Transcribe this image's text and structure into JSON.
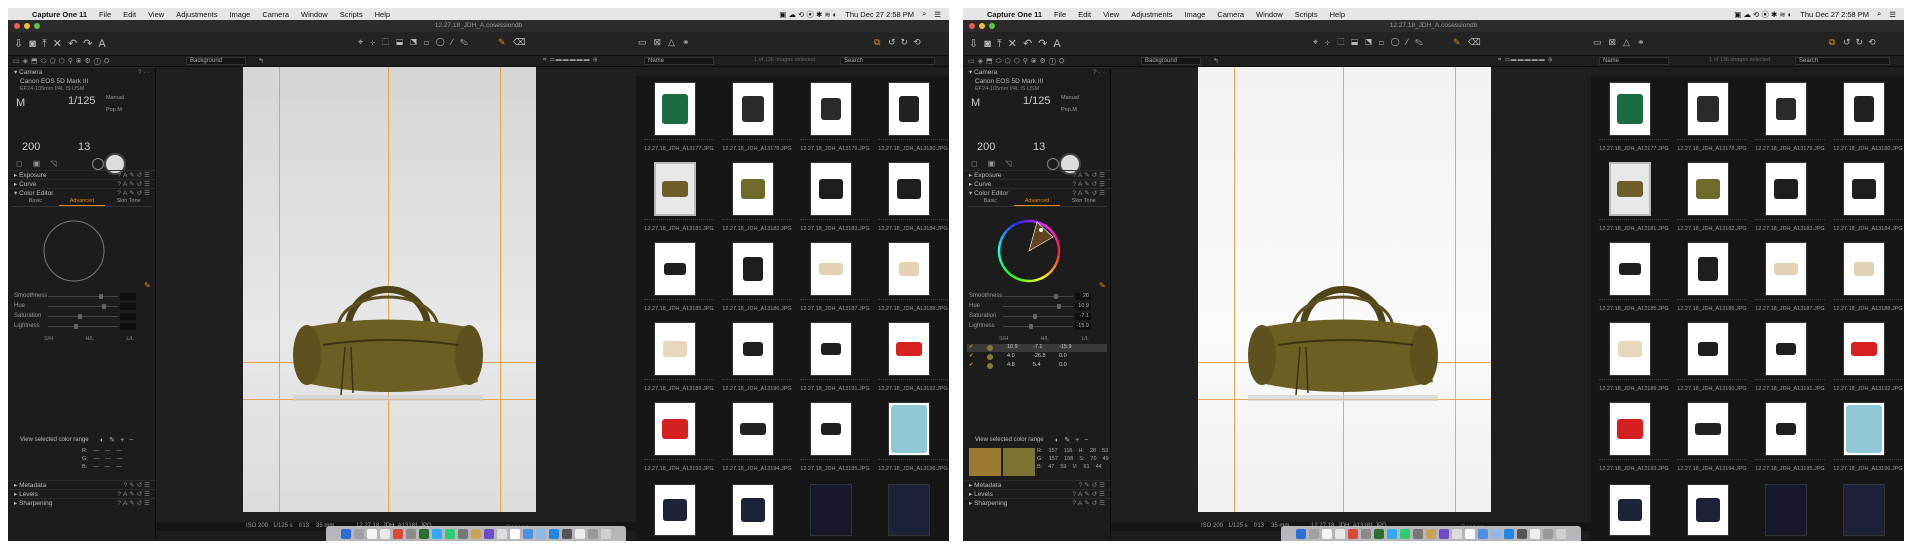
{
  "menubar": {
    "app": "Capture One 11",
    "items": [
      "File",
      "Edit",
      "View",
      "Adjustments",
      "Image",
      "Camera",
      "Window",
      "Scripts",
      "Help"
    ],
    "clock": "Thu Dec 27  2:58 PM"
  },
  "window": {
    "title": "12.27.18_JDH_A.cosessiondb"
  },
  "subbar": {
    "background_label": "Background",
    "filter_label": "Name",
    "selection_status": "1 of 136 images selected",
    "search_placeholder": "Search"
  },
  "left_panel": {
    "camera_title": "Camera",
    "camera_model": "Canon EOS 5D Mark III",
    "lens": "EF24-105mm f/4L IS USM",
    "mode": "M",
    "shutter": "1/125",
    "iso": "200",
    "aperture": "13",
    "manual_label": "Manual",
    "pop_label": "Pop.M",
    "exposure": "Exposure",
    "curve": "Curve",
    "color_editor": "Color Editor",
    "tabs": [
      "Basic",
      "Advanced",
      "Skin Tone"
    ],
    "sliders": [
      "Smoothness",
      "Hue",
      "Saturation",
      "Lightness"
    ],
    "shl_labels": [
      "S/H",
      "H/L",
      "L/L"
    ],
    "view_range": "View selected color range",
    "rgb_labels": [
      "R:",
      "G:",
      "B:"
    ],
    "metadata": "Metadata",
    "levels": "Levels",
    "sharpening": "Sharpening"
  },
  "shots": [
    {
      "slider_values": [
        "",
        "",
        "",
        ""
      ],
      "rows": [],
      "rgb": [
        [
          "—",
          "—",
          "—"
        ],
        [
          "—",
          "—",
          "—"
        ],
        [
          "—",
          "—",
          "—"
        ]
      ]
    },
    {
      "slider_values": [
        "20",
        "10.9",
        "-7.1",
        "-15.9"
      ],
      "rows": [
        [
          "10.9",
          "-7.1",
          "-15.9"
        ],
        [
          "4.0",
          "-26.8",
          "0.0"
        ],
        [
          "4.8",
          "5.4",
          "0.0"
        ]
      ],
      "rgb": [
        [
          "157",
          "116",
          "H:",
          "28",
          "53"
        ],
        [
          "157",
          "108",
          "S:",
          "70",
          "49"
        ],
        [
          "47",
          "59",
          "V:",
          "61",
          "44"
        ]
      ]
    }
  ],
  "viewer": {
    "iso": "ISO 200",
    "shutter": "1/125 s",
    "aperture": "f/13",
    "focal": "35 mm",
    "filename": "12.27.18_JDH_A13181.JPG"
  },
  "browser": {
    "thumbs": [
      {
        "label": "12.27.18_JDH_A13177.JPG",
        "color": "#1b6b43",
        "w": 26,
        "h": 30
      },
      {
        "label": "12.27.18_JDH_A13178.JPG",
        "color": "#2a2a2a",
        "w": 22,
        "h": 26
      },
      {
        "label": "12.27.18_JDH_A13179.JPG",
        "color": "#2a2a2a",
        "w": 20,
        "h": 22
      },
      {
        "label": "12.27.18_JDH_A13180.JPG",
        "color": "#222",
        "w": 20,
        "h": 26
      },
      {
        "label": "12.27.18_JDH_A13181.JPG",
        "color": "#6d5e2a",
        "w": 26,
        "h": 16,
        "selected": true
      },
      {
        "label": "12.27.18_JDH_A13182.JPG",
        "color": "#6e6a2c",
        "w": 24,
        "h": 20
      },
      {
        "label": "12.27.18_JDH_A13183.JPG",
        "color": "#1e1e1e",
        "w": 24,
        "h": 20
      },
      {
        "label": "12.27.18_JDH_A13184.JPG",
        "color": "#1e1e1e",
        "w": 24,
        "h": 20
      },
      {
        "label": "12.27.18_JDH_A13185.JPG",
        "color": "#1e1e1e",
        "w": 22,
        "h": 12
      },
      {
        "label": "12.27.18_JDH_A13186.JPG",
        "color": "#1e1e1e",
        "w": 20,
        "h": 24
      },
      {
        "label": "12.27.18_JDH_A13187.JPG",
        "color": "#e3d3b4",
        "w": 24,
        "h": 12
      },
      {
        "label": "12.27.18_JDH_A13188.JPG",
        "color": "#e3d3b4",
        "w": 20,
        "h": 14
      },
      {
        "label": "12.27.18_JDH_A13189.JPG",
        "color": "#e6d8bd",
        "w": 24,
        "h": 16
      },
      {
        "label": "12.27.18_JDH_A13190.JPG",
        "color": "#1e1e1e",
        "w": 20,
        "h": 14
      },
      {
        "label": "12.27.18_JDH_A13191.JPG",
        "color": "#1e1e1e",
        "w": 20,
        "h": 12
      },
      {
        "label": "12.27.18_JDH_A13192.JPG",
        "color": "#d72020",
        "w": 26,
        "h": 14
      },
      {
        "label": "12.27.18_JDH_A13193.JPG",
        "color": "#d42020",
        "w": 26,
        "h": 20
      },
      {
        "label": "12.27.18_JDH_A13194.JPG",
        "color": "#222",
        "w": 26,
        "h": 12
      },
      {
        "label": "12.27.18_JDH_A13195.JPG",
        "color": "#1e1e1e",
        "w": 20,
        "h": 12
      },
      {
        "label": "12.27.18_JDH_A13196.JPG",
        "color": "#8fc9d4",
        "w": 36,
        "h": 48
      },
      {
        "label": "",
        "color": "#1e2238",
        "w": 24,
        "h": 22
      },
      {
        "label": "",
        "color": "#1e2238",
        "w": 24,
        "h": 24
      },
      {
        "label": "",
        "color": "#15182a",
        "w": 42,
        "h": 54
      },
      {
        "label": "",
        "color": "#1e2238",
        "w": 42,
        "h": 54
      }
    ]
  },
  "colors": {
    "accent": "#e08a1a",
    "panel": "#1c1c1c"
  }
}
